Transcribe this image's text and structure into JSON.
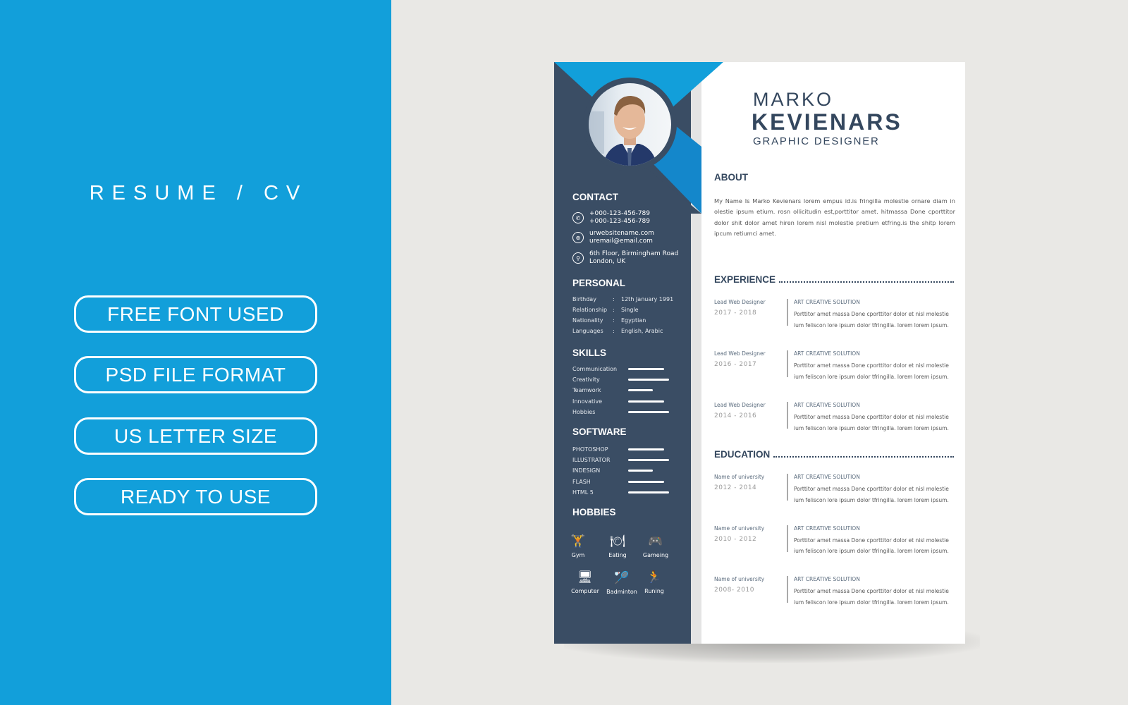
{
  "promo": {
    "title": "RESUME / CV",
    "features": [
      "FREE FONT USED",
      "PSD FILE FORMAT",
      "US LETTER SIZE",
      "READY TO USE"
    ]
  },
  "colors": {
    "left_bg": "#129fda",
    "sidebar": "#3a4d64",
    "accent_light": "#129fda",
    "accent_dark": "#1487cb",
    "heading_text": "#34475e"
  },
  "resume": {
    "first_name": "MARKO",
    "last_name": "KEVIENARS",
    "job_title": "GRAPHIC DESIGNER",
    "sidebar": {
      "contact": {
        "heading": "CONTACT",
        "items": [
          {
            "icon": "phone-icon",
            "glyph": "✆",
            "line1": "+000-123-456-789",
            "line2": "+000-123-456-789"
          },
          {
            "icon": "globe-icon",
            "glyph": "⊕",
            "line1": "urwebsitename.com",
            "line2": "uremail@email.com"
          },
          {
            "icon": "location-pin-icon",
            "glyph": "⚲",
            "line1": "6th Floor, Birmingham Road",
            "line2": "London, UK"
          }
        ]
      },
      "personal": {
        "heading": "PERSONAL",
        "rows": [
          {
            "label": "Birthday",
            "value": "12th January 1991"
          },
          {
            "label": "Relationship",
            "value": "Single"
          },
          {
            "label": "Nationality",
            "value": "Egyptian"
          },
          {
            "label": "Languages",
            "value": "English, Arabic"
          }
        ]
      },
      "skills": {
        "heading": "SKILLS",
        "items": [
          {
            "label": "Communication",
            "level": 0.88
          },
          {
            "label": "Creativity",
            "level": 1.0
          },
          {
            "label": "Teamwork",
            "level": 0.6
          },
          {
            "label": "Innovative",
            "level": 0.88
          },
          {
            "label": "Hobbies",
            "level": 1.0
          }
        ]
      },
      "software": {
        "heading": "SOFTWARE",
        "items": [
          {
            "label": "PHOTOSHOP",
            "level": 0.88
          },
          {
            "label": "ILLUSTRATOR",
            "level": 1.0
          },
          {
            "label": "INDESIGN",
            "level": 0.6
          },
          {
            "label": "FLASH",
            "level": 0.88
          },
          {
            "label": "HTML 5",
            "level": 1.0
          }
        ]
      },
      "hobbies": {
        "heading": "HOBBIES",
        "items": [
          {
            "label": "Gym",
            "icon": "dumbbell-icon",
            "glyph": "🏋"
          },
          {
            "label": "Eating",
            "icon": "dining-icon",
            "glyph": "🍽"
          },
          {
            "label": "Gameing",
            "icon": "gamepad-icon",
            "glyph": "🎮"
          },
          {
            "label": "Computer",
            "icon": "computer-icon",
            "glyph": "🖥"
          },
          {
            "label": "Badminton",
            "icon": "badminton-icon",
            "glyph": "🏸"
          },
          {
            "label": "Runing",
            "icon": "running-icon",
            "glyph": "🏃"
          }
        ]
      }
    },
    "about": {
      "heading": "ABOUT",
      "text": "My Name Is Marko Kevienars lorem empus id.is fringilla molestie ornare diam in olestie ipsum etium. rosn ollicitudin est,porttitor amet. hitmassa Done cporttitor dolor shit dolor amet hiren lorem nisl molestie pretium etfring.is the shitp lorem ipcum retiumci amet."
    },
    "experience": {
      "heading": "EXPERIENCE",
      "items": [
        {
          "role": "Lead  Web Designer",
          "years": "2017 - 2018",
          "company": "ART CREATIVE SOLUTION",
          "desc": "Porttitor amet massa Done cporttitor dolor et nisl molestie ium feliscon lore  ipsum dolor tfringilla. lorem lorem ipsum."
        },
        {
          "role": "Lead  Web Designer",
          "years": "2016 - 2017",
          "company": "ART CREATIVE SOLUTION",
          "desc": "Porttitor amet massa Done cporttitor dolor et nisl molestie ium feliscon lore  ipsum dolor tfringilla. lorem lorem ipsum."
        },
        {
          "role": "Lead  Web Designer",
          "years": "2014 - 2016",
          "company": "ART CREATIVE SOLUTION",
          "desc": "Porttitor amet massa Done cporttitor dolor et nisl molestie ium feliscon lore  ipsum dolor tfringilla. lorem lorem ipsum."
        }
      ]
    },
    "education": {
      "heading": "EDUCATION",
      "items": [
        {
          "role": "Name of university",
          "years": "2012 - 2014",
          "company": "ART CREATIVE SOLUTION",
          "desc": "Porttitor amet massa Done cporttitor dolor et nisl molestie ium feliscon lore  ipsum dolor tfringilla. lorem lorem ipsum."
        },
        {
          "role": "Name of university",
          "years": "2010 - 2012",
          "company": "ART CREATIVE SOLUTION",
          "desc": "Porttitor amet massa Done cporttitor dolor et nisl molestie ium feliscon lore  ipsum dolor tfringilla. lorem lorem ipsum."
        },
        {
          "role": "Name of university",
          "years": " 2008- 2010",
          "company": "ART CREATIVE SOLUTION",
          "desc": "Porttitor amet massa Done cporttitor dolor et nisl molestie ium feliscon lore  ipsum dolor tfringilla. lorem lorem ipsum."
        }
      ]
    }
  }
}
